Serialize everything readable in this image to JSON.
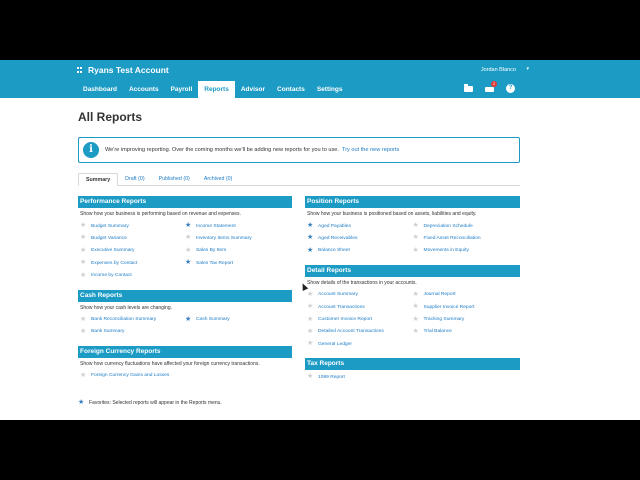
{
  "header": {
    "account_name": "Ryans Test Account",
    "user_name": "Jordan Blanco",
    "user_caret": "▾",
    "notification_count": "2",
    "help_glyph": "?"
  },
  "nav": {
    "tabs": [
      {
        "label": "Dashboard"
      },
      {
        "label": "Accounts"
      },
      {
        "label": "Payroll"
      },
      {
        "label": "Reports",
        "active": true
      },
      {
        "label": "Advisor"
      },
      {
        "label": "Contacts"
      },
      {
        "label": "Settings"
      }
    ]
  },
  "page": {
    "title": "All Reports"
  },
  "notice": {
    "icon": "i",
    "text": "We're improving reporting. Over the coming months we'll be adding new reports for you to use.",
    "link": "Try out the new reports"
  },
  "subtabs": [
    {
      "label": "Summary",
      "active": true
    },
    {
      "label": "Draft (0)"
    },
    {
      "label": "Published (0)"
    },
    {
      "label": "Archived (0)"
    }
  ],
  "star_glyph": "★",
  "colors": {
    "brand": "#1c9bc5",
    "link": "#1c7bc5",
    "favorite_star": "#3a7fc0",
    "unfavorite_star": "#cfcfcf",
    "badge": "#e53935"
  },
  "sections": {
    "performance": {
      "title": "Performance Reports",
      "desc": "Show how your business is performing based on revenue and expenses.",
      "items": [
        {
          "label": "Budget Summary",
          "fav": false
        },
        {
          "label": "Income Statement",
          "fav": true
        },
        {
          "label": "Budget Variance",
          "fav": false
        },
        {
          "label": "Inventory Items Summary",
          "fav": false
        },
        {
          "label": "Executive Summary",
          "fav": false
        },
        {
          "label": "Sales By Item",
          "fav": false
        },
        {
          "label": "Expenses by Contact",
          "fav": false
        },
        {
          "label": "Sales Tax Report",
          "fav": true
        },
        {
          "label": "Income by Contact",
          "fav": false
        }
      ]
    },
    "cash": {
      "title": "Cash Reports",
      "desc": "Show how your cash levels are changing.",
      "items": [
        {
          "label": "Bank Reconciliation Summary",
          "fav": false
        },
        {
          "label": "Cash Summary",
          "fav": true
        },
        {
          "label": "Bank Summary",
          "fav": false
        }
      ]
    },
    "foreign": {
      "title": "Foreign Currency Reports",
      "desc": "Show how currency fluctuations have affected your foreign currency transactions.",
      "items": [
        {
          "label": "Foreign Currency Gains and Losses",
          "fav": false
        }
      ]
    },
    "position": {
      "title": "Position Reports",
      "desc": "Show how your business is positioned based on assets, liabilities and equity.",
      "items": [
        {
          "label": "Aged Payables",
          "fav": true
        },
        {
          "label": "Depreciation Schedule",
          "fav": false
        },
        {
          "label": "Aged Receivables",
          "fav": true
        },
        {
          "label": "Fixed Asset Reconciliation",
          "fav": false
        },
        {
          "label": "Balance Sheet",
          "fav": true
        },
        {
          "label": "Movements in Equity",
          "fav": false
        }
      ]
    },
    "detail": {
      "title": "Detail Reports",
      "desc": "Show details of the transactions in your accounts.",
      "items": [
        {
          "label": "Account Summary",
          "fav": false
        },
        {
          "label": "Journal Report",
          "fav": false
        },
        {
          "label": "Account Transactions",
          "fav": false
        },
        {
          "label": "Supplier Invoice Report",
          "fav": false
        },
        {
          "label": "Customer Invoice Report",
          "fav": false
        },
        {
          "label": "Tracking Summary",
          "fav": false
        },
        {
          "label": "Detailed Account Transactions",
          "fav": false
        },
        {
          "label": "Trial Balance",
          "fav": false
        },
        {
          "label": "General Ledger",
          "fav": false
        }
      ]
    },
    "tax": {
      "title": "Tax Reports",
      "items": [
        {
          "label": "1099 Report",
          "fav": false
        }
      ]
    }
  },
  "footer": {
    "text": "Favorites: Selected reports will appear in the Reports menu."
  }
}
